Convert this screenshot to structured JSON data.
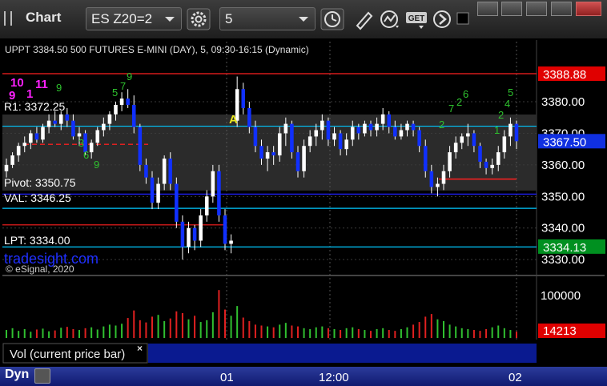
{
  "app": {
    "title": "Chart"
  },
  "toolbar": {
    "symbol": "ES Z20=2",
    "interval": "5"
  },
  "chart_header": "UPPT 3384.50 500 FUTURES E-MINI (DAY), 5, 09:30-16:15 (Dynamic)",
  "chart_data": {
    "type": "candlestick",
    "symbol": "ES Z20=2",
    "title": "S&P 500 FUTURES E-MINI (DAY), 5, 09:30-16:15 (Dynamic)",
    "ylim": [
      3327,
      3397
    ],
    "y_ticks": [
      3380,
      3370,
      3360,
      3350,
      3340,
      3330
    ],
    "x_ticks": [
      "01",
      "12:00",
      "02"
    ],
    "levels": [
      {
        "label": "R1: 3372.25",
        "value": 3372.25,
        "color": "#00c8ff"
      },
      {
        "label": "Pivot: 3350.75",
        "value": 3350.75,
        "color": "#2020ff"
      },
      {
        "label": "VAL: 3346.25",
        "value": 3346.25,
        "color": "#00c8ff"
      },
      {
        "label": "LPT: 3334.00",
        "value": 3334.0,
        "color": "#00c8ff"
      },
      {
        "label": "UPT 3388.88",
        "value": 3388.88,
        "color": "#ff2020"
      }
    ],
    "price_tags": [
      {
        "value": "3388.88",
        "price": 3388.88,
        "bg": "#e00000"
      },
      {
        "value": "3367.50",
        "price": 3367.5,
        "bg": "#1030e0"
      },
      {
        "value": "3334.13",
        "price": 3334.13,
        "bg": "#009020"
      }
    ],
    "volume_panel": {
      "label": "Vol (current price bar)",
      "tick": "100000",
      "last": "14213",
      "ymax": 130000
    },
    "candles": [
      {
        "t": 0,
        "o": 3358,
        "h": 3362,
        "l": 3356,
        "c": 3360
      },
      {
        "t": 1,
        "o": 3360,
        "h": 3364,
        "l": 3359,
        "c": 3363
      },
      {
        "t": 2,
        "o": 3363,
        "h": 3367,
        "l": 3361,
        "c": 3366
      },
      {
        "t": 3,
        "o": 3366,
        "h": 3369,
        "l": 3364,
        "c": 3367
      },
      {
        "t": 4,
        "o": 3367,
        "h": 3371,
        "l": 3365,
        "c": 3370
      },
      {
        "t": 5,
        "o": 3370,
        "h": 3372,
        "l": 3367,
        "c": 3368
      },
      {
        "t": 6,
        "o": 3368,
        "h": 3373,
        "l": 3367,
        "c": 3372
      },
      {
        "t": 7,
        "o": 3372,
        "h": 3376,
        "l": 3370,
        "c": 3374
      },
      {
        "t": 8,
        "o": 3374,
        "h": 3377,
        "l": 3372,
        "c": 3373
      },
      {
        "t": 9,
        "o": 3373,
        "h": 3377,
        "l": 3371,
        "c": 3376
      },
      {
        "t": 10,
        "o": 3376,
        "h": 3378,
        "l": 3372,
        "c": 3374
      },
      {
        "t": 11,
        "o": 3374,
        "h": 3376,
        "l": 3368,
        "c": 3369
      },
      {
        "t": 12,
        "o": 3369,
        "h": 3372,
        "l": 3366,
        "c": 3370
      },
      {
        "t": 13,
        "o": 3370,
        "h": 3371,
        "l": 3363,
        "c": 3364
      },
      {
        "t": 14,
        "o": 3364,
        "h": 3368,
        "l": 3362,
        "c": 3367
      },
      {
        "t": 15,
        "o": 3367,
        "h": 3372,
        "l": 3366,
        "c": 3371
      },
      {
        "t": 16,
        "o": 3371,
        "h": 3375,
        "l": 3369,
        "c": 3373
      },
      {
        "t": 17,
        "o": 3373,
        "h": 3377,
        "l": 3371,
        "c": 3376
      },
      {
        "t": 18,
        "o": 3376,
        "h": 3380,
        "l": 3374,
        "c": 3379
      },
      {
        "t": 19,
        "o": 3379,
        "h": 3383,
        "l": 3377,
        "c": 3381
      },
      {
        "t": 20,
        "o": 3381,
        "h": 3384,
        "l": 3378,
        "c": 3379
      },
      {
        "t": 21,
        "o": 3379,
        "h": 3382,
        "l": 3370,
        "c": 3372
      },
      {
        "t": 22,
        "o": 3372,
        "h": 3373,
        "l": 3358,
        "c": 3360
      },
      {
        "t": 23,
        "o": 3360,
        "h": 3362,
        "l": 3354,
        "c": 3356
      },
      {
        "t": 24,
        "o": 3356,
        "h": 3358,
        "l": 3346,
        "c": 3348
      },
      {
        "t": 25,
        "o": 3348,
        "h": 3356,
        "l": 3346,
        "c": 3354
      },
      {
        "t": 26,
        "o": 3354,
        "h": 3363,
        "l": 3352,
        "c": 3362
      },
      {
        "t": 27,
        "o": 3362,
        "h": 3364,
        "l": 3352,
        "c": 3354
      },
      {
        "t": 28,
        "o": 3354,
        "h": 3356,
        "l": 3340,
        "c": 3342
      },
      {
        "t": 29,
        "o": 3342,
        "h": 3344,
        "l": 3330,
        "c": 3334
      },
      {
        "t": 30,
        "o": 3334,
        "h": 3342,
        "l": 3332,
        "c": 3340
      },
      {
        "t": 31,
        "o": 3340,
        "h": 3341,
        "l": 3333,
        "c": 3336
      },
      {
        "t": 32,
        "o": 3336,
        "h": 3346,
        "l": 3334,
        "c": 3344
      },
      {
        "t": 33,
        "o": 3344,
        "h": 3352,
        "l": 3342,
        "c": 3350
      },
      {
        "t": 34,
        "o": 3350,
        "h": 3360,
        "l": 3348,
        "c": 3358
      },
      {
        "t": 35,
        "o": 3358,
        "h": 3360,
        "l": 3342,
        "c": 3344
      },
      {
        "t": 36,
        "o": 3344,
        "h": 3346,
        "l": 3333,
        "c": 3335
      },
      {
        "t": 37,
        "o": 3335,
        "h": 3338,
        "l": 3332,
        "c": 3336
      },
      {
        "t": 38,
        "o": 3374,
        "h": 3388,
        "l": 3372,
        "c": 3384
      },
      {
        "t": 39,
        "o": 3384,
        "h": 3386,
        "l": 3376,
        "c": 3378
      },
      {
        "t": 40,
        "o": 3378,
        "h": 3380,
        "l": 3370,
        "c": 3372
      },
      {
        "t": 41,
        "o": 3372,
        "h": 3374,
        "l": 3364,
        "c": 3366
      },
      {
        "t": 42,
        "o": 3366,
        "h": 3368,
        "l": 3360,
        "c": 3362
      },
      {
        "t": 43,
        "o": 3362,
        "h": 3366,
        "l": 3358,
        "c": 3364
      },
      {
        "t": 44,
        "o": 3364,
        "h": 3366,
        "l": 3360,
        "c": 3363
      },
      {
        "t": 45,
        "o": 3363,
        "h": 3372,
        "l": 3361,
        "c": 3370
      },
      {
        "t": 46,
        "o": 3370,
        "h": 3375,
        "l": 3366,
        "c": 3373
      },
      {
        "t": 47,
        "o": 3373,
        "h": 3374,
        "l": 3362,
        "c": 3364
      },
      {
        "t": 48,
        "o": 3364,
        "h": 3366,
        "l": 3356,
        "c": 3358
      },
      {
        "t": 49,
        "o": 3358,
        "h": 3368,
        "l": 3356,
        "c": 3366
      },
      {
        "t": 50,
        "o": 3366,
        "h": 3371,
        "l": 3364,
        "c": 3369
      },
      {
        "t": 51,
        "o": 3369,
        "h": 3373,
        "l": 3366,
        "c": 3371
      },
      {
        "t": 52,
        "o": 3371,
        "h": 3376,
        "l": 3368,
        "c": 3374
      },
      {
        "t": 53,
        "o": 3374,
        "h": 3375,
        "l": 3366,
        "c": 3368
      },
      {
        "t": 54,
        "o": 3368,
        "h": 3372,
        "l": 3366,
        "c": 3370
      },
      {
        "t": 55,
        "o": 3370,
        "h": 3371,
        "l": 3363,
        "c": 3365
      },
      {
        "t": 56,
        "o": 3365,
        "h": 3370,
        "l": 3363,
        "c": 3368
      },
      {
        "t": 57,
        "o": 3368,
        "h": 3374,
        "l": 3366,
        "c": 3372
      },
      {
        "t": 58,
        "o": 3372,
        "h": 3373,
        "l": 3368,
        "c": 3370
      },
      {
        "t": 59,
        "o": 3370,
        "h": 3374,
        "l": 3369,
        "c": 3373
      },
      {
        "t": 60,
        "o": 3373,
        "h": 3374,
        "l": 3369,
        "c": 3371
      },
      {
        "t": 61,
        "o": 3371,
        "h": 3375,
        "l": 3369,
        "c": 3373
      },
      {
        "t": 62,
        "o": 3373,
        "h": 3378,
        "l": 3371,
        "c": 3376
      },
      {
        "t": 63,
        "o": 3376,
        "h": 3377,
        "l": 3370,
        "c": 3372
      },
      {
        "t": 64,
        "o": 3372,
        "h": 3374,
        "l": 3368,
        "c": 3369
      },
      {
        "t": 65,
        "o": 3369,
        "h": 3373,
        "l": 3368,
        "c": 3371
      },
      {
        "t": 66,
        "o": 3371,
        "h": 3374,
        "l": 3369,
        "c": 3373
      },
      {
        "t": 67,
        "o": 3373,
        "h": 3374,
        "l": 3369,
        "c": 3371
      },
      {
        "t": 68,
        "o": 3371,
        "h": 3372,
        "l": 3364,
        "c": 3366
      },
      {
        "t": 69,
        "o": 3366,
        "h": 3368,
        "l": 3356,
        "c": 3358
      },
      {
        "t": 70,
        "o": 3358,
        "h": 3360,
        "l": 3351,
        "c": 3353
      },
      {
        "t": 71,
        "o": 3353,
        "h": 3356,
        "l": 3350,
        "c": 3354
      },
      {
        "t": 72,
        "o": 3354,
        "h": 3360,
        "l": 3352,
        "c": 3358
      },
      {
        "t": 73,
        "o": 3358,
        "h": 3366,
        "l": 3356,
        "c": 3364
      },
      {
        "t": 74,
        "o": 3364,
        "h": 3369,
        "l": 3362,
        "c": 3367
      },
      {
        "t": 75,
        "o": 3367,
        "h": 3370,
        "l": 3365,
        "c": 3369
      },
      {
        "t": 76,
        "o": 3369,
        "h": 3373,
        "l": 3366,
        "c": 3370
      },
      {
        "t": 77,
        "o": 3370,
        "h": 3371,
        "l": 3364,
        "c": 3366
      },
      {
        "t": 78,
        "o": 3366,
        "h": 3367,
        "l": 3359,
        "c": 3361
      },
      {
        "t": 79,
        "o": 3361,
        "h": 3362,
        "l": 3357,
        "c": 3359
      },
      {
        "t": 80,
        "o": 3359,
        "h": 3362,
        "l": 3357,
        "c": 3360
      },
      {
        "t": 81,
        "o": 3360,
        "h": 3366,
        "l": 3358,
        "c": 3364
      },
      {
        "t": 82,
        "o": 3364,
        "h": 3371,
        "l": 3362,
        "c": 3369
      },
      {
        "t": 83,
        "o": 3369,
        "h": 3375,
        "l": 3366,
        "c": 3373
      },
      {
        "t": 84,
        "o": 3373,
        "h": 3374,
        "l": 3365,
        "c": 3367.5
      }
    ],
    "volume": [
      18000,
      22000,
      16000,
      20000,
      14000,
      19000,
      21000,
      15000,
      17000,
      23000,
      25000,
      20000,
      18000,
      22000,
      24000,
      19000,
      26000,
      30000,
      28000,
      32000,
      45000,
      62000,
      40000,
      35000,
      48000,
      52000,
      38000,
      44000,
      60000,
      56000,
      42000,
      50000,
      36000,
      40000,
      58000,
      108000,
      64000,
      50000,
      72000,
      46000,
      38000,
      30000,
      28000,
      26000,
      24000,
      30000,
      34000,
      28000,
      26000,
      22000,
      20000,
      24000,
      26000,
      22000,
      20000,
      18000,
      22000,
      24000,
      20000,
      18000,
      16000,
      20000,
      22000,
      18000,
      16000,
      20000,
      24000,
      30000,
      36000,
      48000,
      54000,
      42000,
      38000,
      30000,
      26000,
      22000,
      20000,
      18000,
      16000,
      20000,
      24000,
      28000,
      22000,
      18000,
      14213
    ]
  },
  "annotations": {
    "ul_label": "UPPT 3384.50",
    "r1": "R1: 3372.25",
    "pivot": "Pivot: 3350.75",
    "val": "VAL: 3346.25",
    "lpt": "LPT: 3334.00",
    "watermark": "tradesight.com",
    "copyright": "© eSignal, 2020",
    "marker_a": "A",
    "magenta_counts": [
      "10",
      "9",
      "1",
      "11"
    ],
    "green_counts": [
      "9",
      "9",
      "7",
      "5",
      "9",
      "3",
      "6",
      "2",
      "6",
      "2",
      "7",
      "5",
      "4",
      "2",
      "1"
    ]
  },
  "x_labels": [
    "01",
    "12:00",
    "02"
  ],
  "status": {
    "mode": "Dyn"
  }
}
